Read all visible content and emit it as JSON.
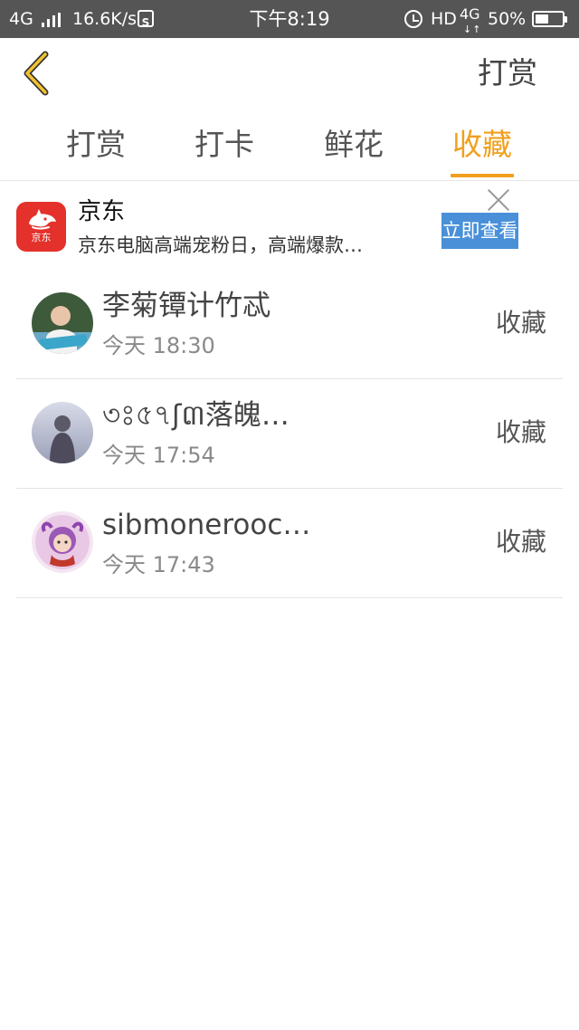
{
  "status_bar": {
    "network": "4G",
    "speed": "16.6K/s",
    "s_badge": "S",
    "time": "下午8:19",
    "hd": "HD",
    "data_type": "4G",
    "data_arrows": "↓↑",
    "battery_text": "50%",
    "battery_level": 0.5
  },
  "header": {
    "action_label": "打赏"
  },
  "tabs": [
    {
      "label": "打赏",
      "active": false
    },
    {
      "label": "打卡",
      "active": false
    },
    {
      "label": "鲜花",
      "active": false
    },
    {
      "label": "收藏",
      "active": true
    }
  ],
  "ad": {
    "logo_text": "京东",
    "title": "京东",
    "description": "京东电脑高端宠粉日，高端爆款…",
    "button_label": "立即查看"
  },
  "list": [
    {
      "name": "李菊镡计竹忒",
      "time": "今天 18:30",
      "action": "收藏"
    },
    {
      "name": "৩ঃ৫৭ʃ៣落魄…",
      "time": "今天 17:54",
      "action": "收藏"
    },
    {
      "name": "sibmonerooc…",
      "time": "今天 17:43",
      "action": "收藏"
    }
  ],
  "colors": {
    "accent": "#f0a01e",
    "status_bar": "#555555",
    "ad_button": "#4a90d9",
    "jd_red": "#e4312b"
  }
}
